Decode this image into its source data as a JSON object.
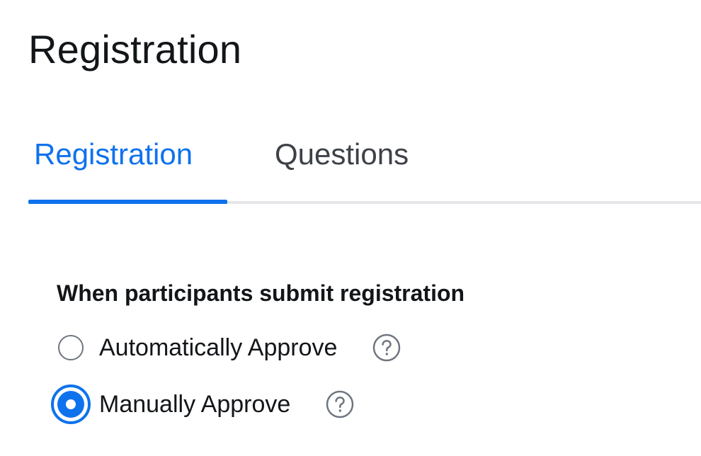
{
  "page": {
    "title": "Registration"
  },
  "tabs": [
    {
      "label": "Registration",
      "active": true
    },
    {
      "label": "Questions",
      "active": false
    }
  ],
  "approval": {
    "label": "When participants submit registration",
    "options": [
      {
        "label": "Automatically Approve",
        "selected": false,
        "help_icon": "question-circle-icon"
      },
      {
        "label": "Manually Approve",
        "selected": true,
        "help_icon": "question-circle-icon"
      }
    ]
  },
  "colors": {
    "accent": "#0e72ed",
    "text": "#131619",
    "inactive_tab": "#3d4147",
    "divider": "#e4e6e9",
    "icon_gray": "#6e7680"
  }
}
